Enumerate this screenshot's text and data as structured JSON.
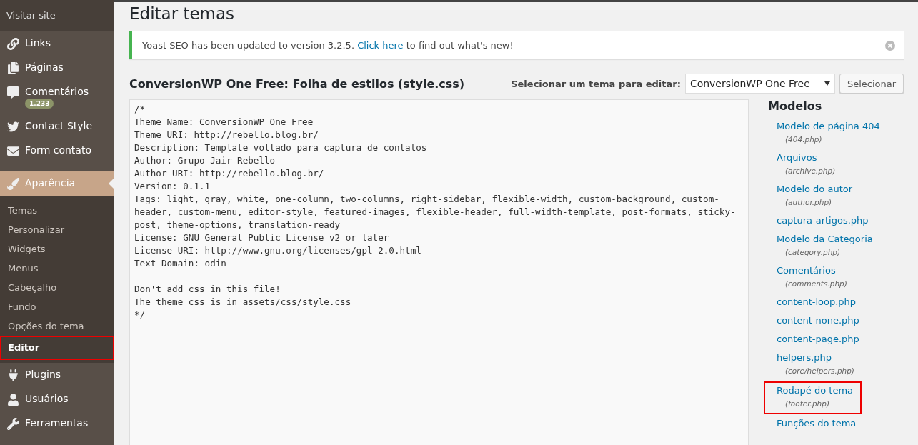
{
  "sidebar": {
    "visit_site": "Visitar site",
    "menu": [
      {
        "label": "Links",
        "selected": false
      },
      {
        "label": "Páginas",
        "selected": false
      },
      {
        "label": "Comentários",
        "selected": false,
        "badge": "1.233"
      },
      {
        "label": "Contact Style",
        "selected": false
      },
      {
        "label": "Form contato",
        "selected": false
      },
      {
        "label": "Aparência",
        "selected": true,
        "submenu": [
          {
            "label": "Temas",
            "selected": false,
            "highlighted": false
          },
          {
            "label": "Personalizar",
            "selected": false,
            "highlighted": false
          },
          {
            "label": "Widgets",
            "selected": false,
            "highlighted": false
          },
          {
            "label": "Menus",
            "selected": false,
            "highlighted": false
          },
          {
            "label": "Cabeçalho",
            "selected": false,
            "highlighted": false
          },
          {
            "label": "Fundo",
            "selected": false,
            "highlighted": false
          },
          {
            "label": "Opções do tema",
            "selected": false,
            "highlighted": false
          },
          {
            "label": "Editor",
            "selected": true,
            "highlighted": true
          }
        ]
      },
      {
        "label": "Plugins",
        "selected": false
      },
      {
        "label": "Usuários",
        "selected": false
      },
      {
        "label": "Ferramentas",
        "selected": false
      }
    ]
  },
  "page_title": "Editar temas",
  "notice": {
    "text": "Yoast SEO has been updated to version 3.2.5.",
    "link": "Click here",
    "text_after": "to find out what's new!"
  },
  "file_heading": "ConversionWP One Free: Folha de estilos (style.css)",
  "theme_select": {
    "label": "Selecionar um tema para editar:",
    "value": "ConversionWP One Free",
    "button": "Selecionar"
  },
  "editor": {
    "content": "/*\nTheme Name: ConversionWP One Free\nTheme URI: http://rebello.blog.br/\nDescription: Template voltado para captura de contatos\nAuthor: Grupo Jair Rebello\nAuthor URI: http://rebello.blog.br/\nVersion: 0.1.1\nTags: light, gray, white, one-column, two-columns, right-sidebar, flexible-width, custom-background, custom-header, custom-menu, editor-style, featured-images, flexible-header, full-width-template, post-formats, sticky-post, theme-options, translation-ready\nLicense: GNU General Public License v2 or later\nLicense URI: http://www.gnu.org/licenses/gpl-2.0.html\nText Domain: odin\n\nDon't add css in this file!\nThe theme css is in assets/css/style.css\n*/"
  },
  "templates": {
    "title": "Modelos",
    "items": [
      {
        "name": "Modelo de página 404",
        "file": "(404.php)",
        "highlighted": false
      },
      {
        "name": "Arquivos",
        "file": "(archive.php)",
        "highlighted": false
      },
      {
        "name": "Modelo do autor",
        "file": "(author.php)",
        "highlighted": false
      },
      {
        "name": "captura-artigos.php",
        "highlighted": false
      },
      {
        "name": "Modelo da Categoria",
        "file": "(category.php)",
        "highlighted": false
      },
      {
        "name": "Comentários",
        "file": "(comments.php)",
        "highlighted": false
      },
      {
        "name": "content-loop.php",
        "highlighted": false
      },
      {
        "name": "content-none.php",
        "highlighted": false
      },
      {
        "name": "content-page.php",
        "highlighted": false
      },
      {
        "name": "helpers.php",
        "file": "(core/helpers.php)",
        "highlighted": false
      },
      {
        "name": "Rodapé do tema",
        "file": "(footer.php)",
        "highlighted": true
      },
      {
        "name": "Funções do tema",
        "highlighted": false
      }
    ]
  }
}
